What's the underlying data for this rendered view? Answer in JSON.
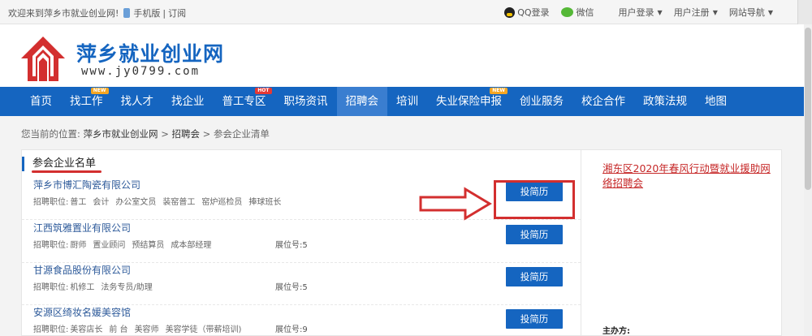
{
  "topbar": {
    "welcome": "欢迎来到萍乡市就业创业网!",
    "mobile": "手机版",
    "sep": "|",
    "subscribe": "订阅",
    "qq_login": "QQ登录",
    "wechat": "微信",
    "user_login": "用户登录",
    "user_register": "用户注册",
    "site_nav": "网站导航"
  },
  "header": {
    "site_name": "萍乡就业创业网",
    "site_url": "www.jy0799.com",
    "brand_color": "#1565c0",
    "logo_color": "#d32f2f"
  },
  "nav": {
    "items": [
      {
        "label": "首页",
        "badge": ""
      },
      {
        "label": "找工作",
        "badge": "NEW"
      },
      {
        "label": "找人才",
        "badge": ""
      },
      {
        "label": "找企业",
        "badge": ""
      },
      {
        "label": "普工专区",
        "badge": "HOT"
      },
      {
        "label": "职场资讯",
        "badge": ""
      },
      {
        "label": "招聘会",
        "badge": "",
        "active": true
      },
      {
        "label": "培训",
        "badge": ""
      },
      {
        "label": "失业保险申报",
        "badge": "NEW"
      },
      {
        "label": "创业服务",
        "badge": ""
      },
      {
        "label": "校企合作",
        "badge": ""
      },
      {
        "label": "政策法规",
        "badge": ""
      },
      {
        "label": "地图",
        "badge": ""
      }
    ]
  },
  "breadcrumb": {
    "prefix": "您当前的位置:",
    "home": "萍乡市就业创业网",
    "gt1": ">",
    "level2": "招聘会",
    "gt2": ">",
    "current": "参会企业清单"
  },
  "main": {
    "section_title": "参会企业名单",
    "apply_label": "投简历",
    "positions_prefix": "招聘职位:",
    "companies": [
      {
        "name": "萍乡市博汇陶瓷有限公司",
        "positions": [
          "普工",
          "会计",
          "办公室文员",
          "装窑普工",
          "窑炉巡检员",
          "捧球班长"
        ],
        "booth": ""
      },
      {
        "name": "江西筑雅置业有限公司",
        "positions": [
          "厨师",
          "置业顾问",
          "预结算员",
          "成本部经理"
        ],
        "booth": "展位号:5"
      },
      {
        "name": "甘源食品股份有限公司",
        "positions": [
          "机修工",
          "法务专员/助理"
        ],
        "booth": "展位号:5"
      },
      {
        "name": "安源区绮妆名媛美容馆",
        "positions": [
          "美容店长",
          "前 台",
          "美容师",
          "美容学徒（带薪培训)"
        ],
        "booth": "展位号:9"
      }
    ]
  },
  "side": {
    "link": "湘东区2020年春风行动暨就业援助网络招聘会",
    "host_label": "主办方:"
  }
}
